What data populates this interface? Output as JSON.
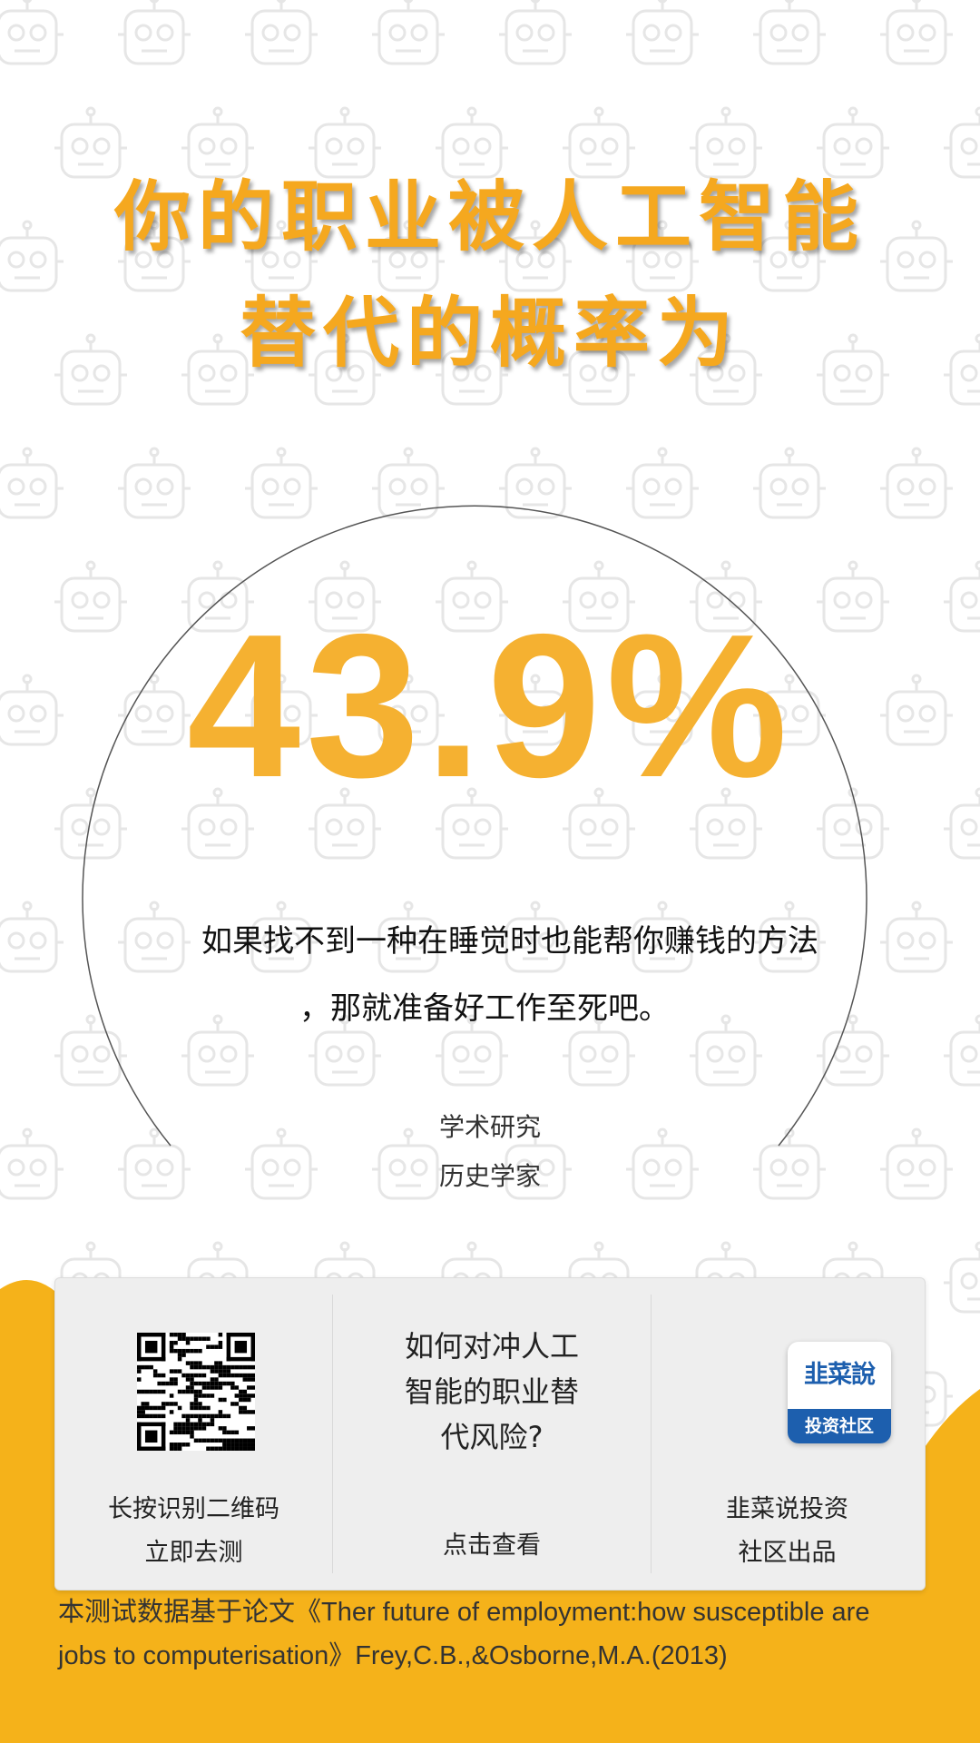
{
  "title": {
    "line1": "你的职业被人工智能",
    "line2": "替代的概率为"
  },
  "result": {
    "percentage": "43.9%",
    "quote_line1": "如果找不到一种在睡觉时也能帮你赚钱的方法",
    "quote_line2": "，那就准备好工作至死吧。",
    "category": "学术研究",
    "occupation": "历史学家"
  },
  "card": {
    "qr_line1": "长按识别二维码",
    "qr_line2": "立即去测",
    "question_line1": "如何对冲人工",
    "question_line2": "智能的职业替",
    "question_line3": "代风险?",
    "view_label": "点击查看",
    "logo_top": "韭菜說",
    "logo_bottom": "投资社区",
    "org_line1": "韭菜说投资",
    "org_line2": "社区出品"
  },
  "footnote": {
    "line1": "本测试数据基于论文《Ther future of employment:how susceptible are",
    "line2": "jobs to computerisation》Frey,C.B.,&Osborne,M.A.(2013)"
  },
  "colors": {
    "accent": "#f5a81f",
    "percent": "#f5b131",
    "logo_blue": "#1d5fae"
  },
  "icons": [
    "robot-pattern-icon",
    "qr-code-icon",
    "brand-logo-icon"
  ]
}
